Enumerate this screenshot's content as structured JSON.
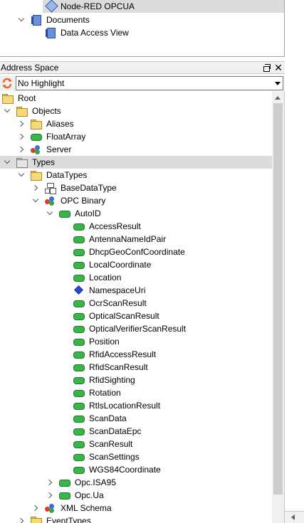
{
  "project_tree": {
    "items": [
      {
        "label": "Node-RED OPCUA",
        "icon": "node-icon",
        "selected": true
      },
      {
        "label": "Documents",
        "icon": "document-icon",
        "expanded": true
      },
      {
        "label": "Data Access View",
        "icon": "document-icon"
      }
    ]
  },
  "address_space": {
    "title": "Address Space",
    "restore_icon": "restore-window-icon",
    "close_label": "✕",
    "highlight_select": "No Highlight",
    "refresh_icon": "refresh-icon"
  },
  "tree": [
    {
      "label": "Root",
      "level": 0,
      "expander": "none",
      "icon": "folder"
    },
    {
      "label": "Objects",
      "level": 0,
      "expander": "down",
      "icon": "folder"
    },
    {
      "label": "Aliases",
      "level": 1,
      "expander": "right",
      "icon": "folder"
    },
    {
      "label": "FloatArray",
      "level": 1,
      "expander": "right",
      "icon": "var"
    },
    {
      "label": "Server",
      "level": 1,
      "expander": "right",
      "icon": "type"
    },
    {
      "label": "Types",
      "level": 0,
      "expander": "down",
      "icon": "folder-gray",
      "selected": true
    },
    {
      "label": "DataTypes",
      "level": 1,
      "expander": "down",
      "icon": "folder"
    },
    {
      "label": "BaseDataType",
      "level": 2,
      "expander": "right",
      "icon": "base"
    },
    {
      "label": "OPC Binary",
      "level": 2,
      "expander": "down",
      "icon": "type"
    },
    {
      "label": "AutoID",
      "level": 3,
      "expander": "down",
      "icon": "obj"
    },
    {
      "label": "AccessResult",
      "level": 4,
      "expander": "none",
      "icon": "var"
    },
    {
      "label": "AntennaNameIdPair",
      "level": 4,
      "expander": "none",
      "icon": "var"
    },
    {
      "label": "DhcpGeoConfCoordinate",
      "level": 4,
      "expander": "none",
      "icon": "var"
    },
    {
      "label": "LocalCoordinate",
      "level": 4,
      "expander": "none",
      "icon": "var"
    },
    {
      "label": "Location",
      "level": 4,
      "expander": "none",
      "icon": "var"
    },
    {
      "label": "NamespaceUri",
      "level": 4,
      "expander": "none",
      "icon": "diamond"
    },
    {
      "label": "OcrScanResult",
      "level": 4,
      "expander": "none",
      "icon": "var"
    },
    {
      "label": "OpticalScanResult",
      "level": 4,
      "expander": "none",
      "icon": "var"
    },
    {
      "label": "OpticalVerifierScanResult",
      "level": 4,
      "expander": "none",
      "icon": "var"
    },
    {
      "label": "Position",
      "level": 4,
      "expander": "none",
      "icon": "var"
    },
    {
      "label": "RfidAccessResult",
      "level": 4,
      "expander": "none",
      "icon": "var"
    },
    {
      "label": "RfidScanResult",
      "level": 4,
      "expander": "none",
      "icon": "var"
    },
    {
      "label": "RfidSighting",
      "level": 4,
      "expander": "none",
      "icon": "var"
    },
    {
      "label": "Rotation",
      "level": 4,
      "expander": "none",
      "icon": "var"
    },
    {
      "label": "RtlsLocationResult",
      "level": 4,
      "expander": "none",
      "icon": "var"
    },
    {
      "label": "ScanData",
      "level": 4,
      "expander": "none",
      "icon": "var"
    },
    {
      "label": "ScanDataEpc",
      "level": 4,
      "expander": "none",
      "icon": "var"
    },
    {
      "label": "ScanResult",
      "level": 4,
      "expander": "none",
      "icon": "var"
    },
    {
      "label": "ScanSettings",
      "level": 4,
      "expander": "none",
      "icon": "var"
    },
    {
      "label": "WGS84Coordinate",
      "level": 4,
      "expander": "none",
      "icon": "var"
    },
    {
      "label": "Opc.ISA95",
      "level": 3,
      "expander": "right",
      "icon": "obj"
    },
    {
      "label": "Opc.Ua",
      "level": 3,
      "expander": "right",
      "icon": "obj"
    },
    {
      "label": "XML Schema",
      "level": 2,
      "expander": "right",
      "icon": "type"
    },
    {
      "label": "EventTypes",
      "level": 1,
      "expander": "right",
      "icon": "folder"
    }
  ]
}
